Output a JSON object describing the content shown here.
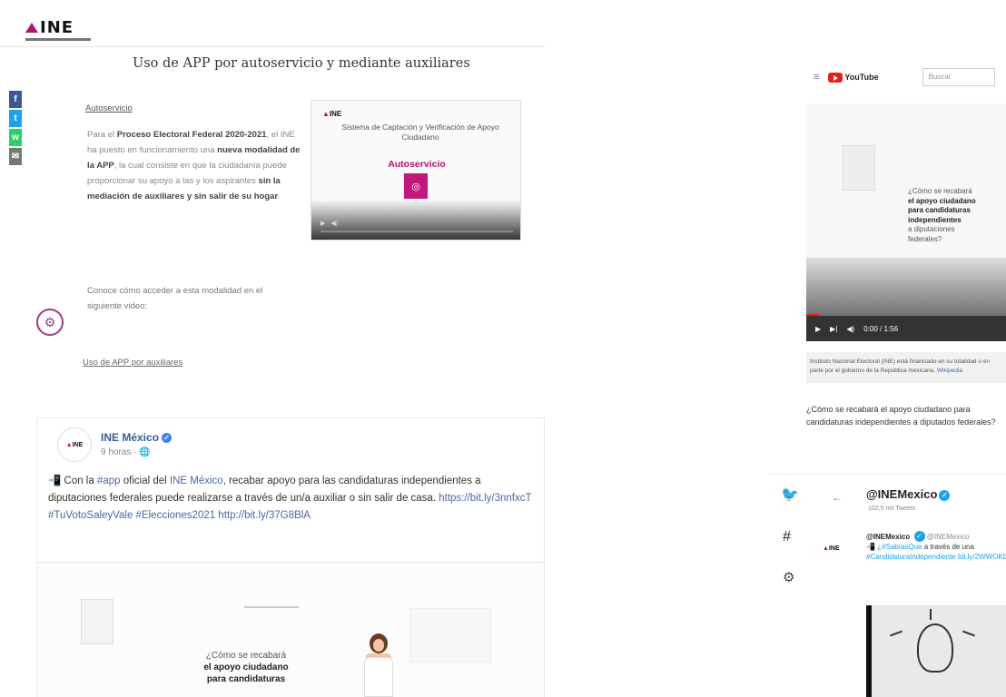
{
  "ine": {
    "logo_text": "INE",
    "page_title": "Uso de APP por autoservicio y mediante auxiliares",
    "share": [
      {
        "name": "facebook-share",
        "glyph": "f"
      },
      {
        "name": "twitter-share",
        "glyph": "t"
      },
      {
        "name": "whatsapp-share",
        "glyph": "w"
      },
      {
        "name": "email-share",
        "glyph": "✉"
      }
    ],
    "autoservicio_heading": "Autoservicio",
    "autoservicio_text_parts": [
      {
        "t": "Para el ",
        "b": false
      },
      {
        "t": "Proceso Electoral Federal 2020-2021",
        "b": true
      },
      {
        "t": ", el INE ha puesto en funcionamiento una ",
        "b": false
      },
      {
        "t": "nueva modalidad de la APP",
        "b": true
      },
      {
        "t": ", la cual consiste en que la ciudadanía puede proporcionar su apoyo a las y los aspirantes ",
        "b": false
      },
      {
        "t": "sin la mediación de auxiliares y sin salir de su hogar",
        "b": true
      }
    ],
    "conoce_text": "Conoce cómo acceder a esta modalidad en el siguiente video:",
    "aux_link": "Uso de APP por auxiliares",
    "video": {
      "logo": "INE",
      "title": "Sistema de Captación y Verificación de Apoyo Ciudadano",
      "subtitle": "Autoservicio"
    }
  },
  "fb_post": {
    "avatar_text": "INE",
    "name": "INE México",
    "time": "9 horas · 🌐",
    "text_parts": [
      {
        "t": "📲 Con la ",
        "tag": false
      },
      {
        "t": "#app",
        "tag": true
      },
      {
        "t": " oficial del ",
        "tag": false
      },
      {
        "t": "INE México",
        "tag": true
      },
      {
        "t": ", recabar apoyo para las candidaturas independientes a diputaciones federales puede realizarse a través de un/a auxiliar o sin salir de casa. ",
        "tag": false
      },
      {
        "t": "https://bit.ly/3nnfxcT",
        "tag": true
      },
      {
        "t": " ",
        "tag": false
      },
      {
        "t": "#TuVotoSaleyVale",
        "tag": true
      },
      {
        "t": " ",
        "tag": false
      },
      {
        "t": "#Elecciones2021",
        "tag": true
      },
      {
        "t": " ",
        "tag": false
      },
      {
        "t": "http://bit.ly/37G8BlA",
        "tag": true
      }
    ],
    "image_caption_line1": "¿Cómo se recabará",
    "image_caption_line2": "el apoyo ciudadano",
    "image_caption_line3": "para candidaturas"
  },
  "youtube": {
    "menu_icon": "≡",
    "logo_text": "YouTube",
    "search_placeholder": "Buscar",
    "caption_line1": "¿Cómo se recabará",
    "caption_line2": "el apoyo ciudadano",
    "caption_line3": "para candidaturas",
    "caption_line4": "independientes",
    "caption_line5": "a diputaciones",
    "caption_line6": "federales?",
    "time": "0:00 / 1:56",
    "info_text": "Instituto Nacional Electoral (INE) está financiado en su totalidad o en parte por el gobierno de la República mexicana.",
    "info_link": "Wikipedia",
    "question": "¿Cómo se recabará el apoyo ciudadano para candidaturas independientes a diputados federales?"
  },
  "twitter": {
    "handle": "@INEMexico",
    "tweet_count": "102,5 mil Tweets",
    "avatar_text": "INE",
    "tweet_name": "@INEMexico",
    "tweet_handle": "@INEMexico",
    "tweet_parts": [
      {
        "t": "📲 ",
        "tag": false
      },
      {
        "t": "¿#SabíasQue",
        "tag": true
      },
      {
        "t": " a través de una ",
        "tag": false
      },
      {
        "t": "#CandidaturaIndependiente",
        "tag": true
      },
      {
        "t": " ",
        "tag": false
      },
      {
        "t": "bit.ly/2WWOKbv",
        "tag": true
      }
    ]
  }
}
